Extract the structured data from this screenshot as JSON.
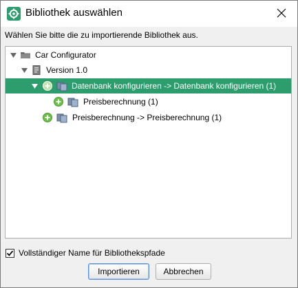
{
  "window": {
    "title": "Bibliothek auswählen",
    "accent_color": "#2e9d6e",
    "app_icon": "gear-icon",
    "close_icon": "close-icon"
  },
  "instruction": "Wählen Sie bitte die zu importierende Bibliothek aus.",
  "tree": {
    "nodes": [
      {
        "label": "Car Configurator",
        "icon": "folder-icon",
        "expanded": true,
        "selected": false
      },
      {
        "label": "Version 1.0",
        "icon": "version-icon",
        "expanded": true,
        "selected": false
      },
      {
        "label": "Datenbank konfigurieren -> Datenbank konfigurieren (1)",
        "icon": "library-icon",
        "expanded": true,
        "selected": true,
        "addable": true
      },
      {
        "label": "Preisberechnung (1)",
        "icon": "library-icon",
        "expanded": false,
        "selected": false,
        "addable": true
      },
      {
        "label": "Preisberechnung -> Preisberechnung (1)",
        "icon": "library-icon",
        "expanded": false,
        "selected": false,
        "addable": true
      }
    ]
  },
  "options": {
    "full_name_label": "Vollständiger Name für Bibliothekspfade",
    "full_name_checked": true
  },
  "buttons": {
    "import_label": "Importieren",
    "cancel_label": "Abbrechen"
  }
}
